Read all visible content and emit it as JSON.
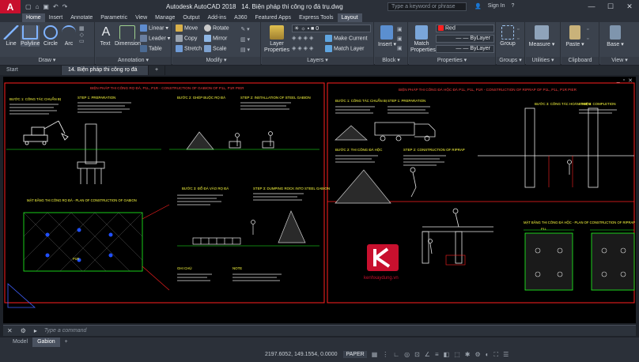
{
  "titlebar": {
    "app_title": "Autodesk AutoCAD 2018",
    "doc_title": "14. Biện pháp thi công rọ đá trụ.dwg",
    "search_placeholder": "Type a keyword or phrase",
    "sign_in": "Sign In"
  },
  "menu": [
    "Home",
    "Insert",
    "Annotate",
    "Parametric",
    "View",
    "Manage",
    "Output",
    "Add-ins",
    "A360",
    "Featured Apps",
    "Express Tools",
    "Layout"
  ],
  "ribbon": {
    "draw": {
      "label": "Draw",
      "line": "Line",
      "polyline": "Polyline",
      "circle": "Circle",
      "arc": "Arc"
    },
    "annotation": {
      "label": "Annotation",
      "text": "Text",
      "dimension": "Dimension",
      "linear": "Linear",
      "leader": "Leader",
      "table": "Table"
    },
    "modify": {
      "label": "Modify",
      "move": "Move",
      "rotate": "Rotate",
      "copy": "Copy",
      "mirror": "Mirror",
      "stretch": "Stretch",
      "scale": "Scale"
    },
    "layers": {
      "label": "Layers",
      "properties": "Layer Properties",
      "current_layer": "0",
      "make_current": "Make Current",
      "match_layer": "Match Layer"
    },
    "block": {
      "label": "Block",
      "insert": "Insert"
    },
    "properties": {
      "label": "Properties",
      "match": "Match Properties",
      "color": "Red",
      "linetype": "ByLayer",
      "lineweight": "ByLayer"
    },
    "groups": {
      "label": "Groups",
      "group": "Group"
    },
    "utilities": {
      "label": "Utilities",
      "measure": "Measure"
    },
    "clipboard": {
      "label": "Clipboard",
      "paste": "Paste"
    },
    "view": {
      "label": "View",
      "base": "Base"
    }
  },
  "doctabs": {
    "start": "Start",
    "active": "14. Biện pháp thi công rọ đá trụ*",
    "plus": "+"
  },
  "drawing": {
    "title_left": "BIỆN PHÁP THI CÔNG RỌ ĐÁ, P1L, P1R - CONSTRUCTION OF GABION OF P1L, P1R PIER",
    "title_right": "BIỆN PHÁP THI CÔNG ĐÁ HỘC ĐÁ P1L, P1L, P1R - CONSTRUCTION OF RIPRAP OF P1L, P1L, P1R PIER",
    "step1": "BƯỚC 1: CÔNG TÁC CHUẨN BỊ",
    "step1_en": "STEP 1: PREPARATION",
    "step2": "BƯỚC 2: GHÉP BUỘC RỌ ĐÁ",
    "step2_en": "STEP 2: INSTALLATION OF STEEL GABION",
    "step3": "BƯỚC 3: ĐỔ ĐÁ VÀO RỌ ĐÁ",
    "step3_en": "STEP 3: DUMPING ROCK INTO STEEL GABION",
    "plan_left": "MẶT BẰNG THI CÔNG RỌ ĐÁ - PLAN OF CONSTRUCTION OF GABION",
    "plan_right": "MẶT BẰNG THI CÔNG ĐÁ HỘC - PLAN OF CONSTRUCTION OF RIPRAP",
    "ghichu": "GHI CHÚ",
    "note": "NOTE",
    "r_step1": "BƯỚC 1: CÔNG TÁC CHUẨN BỊ",
    "r_step1_en": "STEP 1: PREPARATION",
    "r_step2": "BƯỚC 2: THI CÔNG ĐÁ HỘC",
    "r_step2_en": "STEP 2: CONSTRUCTION OF RIPRAP",
    "r_step3": "BƯỚC 3: CÔNG TÁC HOÀN THIỆN",
    "r_step3_en": "STEP 3: COMPLETION",
    "p1r": "P1R",
    "p1l": "P1L",
    "watermark": "kenhxaydung.vn"
  },
  "cmdline": {
    "placeholder": "Type a command"
  },
  "layouts": [
    "Model",
    "Gabion",
    "+"
  ],
  "status": {
    "coords": "2197.6052, 149.1554, 0.0000",
    "paper": "PAPER"
  },
  "colors": {
    "accent": "#c8102e",
    "cad_red": "#ff2020",
    "cad_green": "#20ff20",
    "cad_yellow": "#ffff40"
  }
}
